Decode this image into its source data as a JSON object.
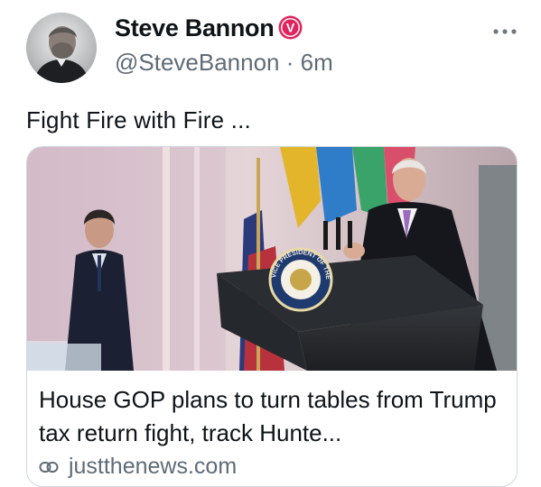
{
  "tweet": {
    "author": {
      "name": "Steve Bannon",
      "handle": "@SteveBannon",
      "verified_glyph": "V",
      "verified_color": "#e0245e"
    },
    "separator": "·",
    "time_ago": "6m",
    "text": "Fight Fire with Fire ...",
    "card": {
      "title": "House GOP plans to turn tables from Trump tax return fight, track Hunte...",
      "domain": "justthenews.com",
      "seal_text": "VICE PRESIDENT OF THE UNITED STATES"
    }
  },
  "icons": {
    "more": "more-horizontal-icon",
    "link": "link-icon",
    "verified": "verified-badge-icon"
  },
  "colors": {
    "text": "#0f1419",
    "secondary": "#5f6b76",
    "border": "#cfd9de"
  }
}
